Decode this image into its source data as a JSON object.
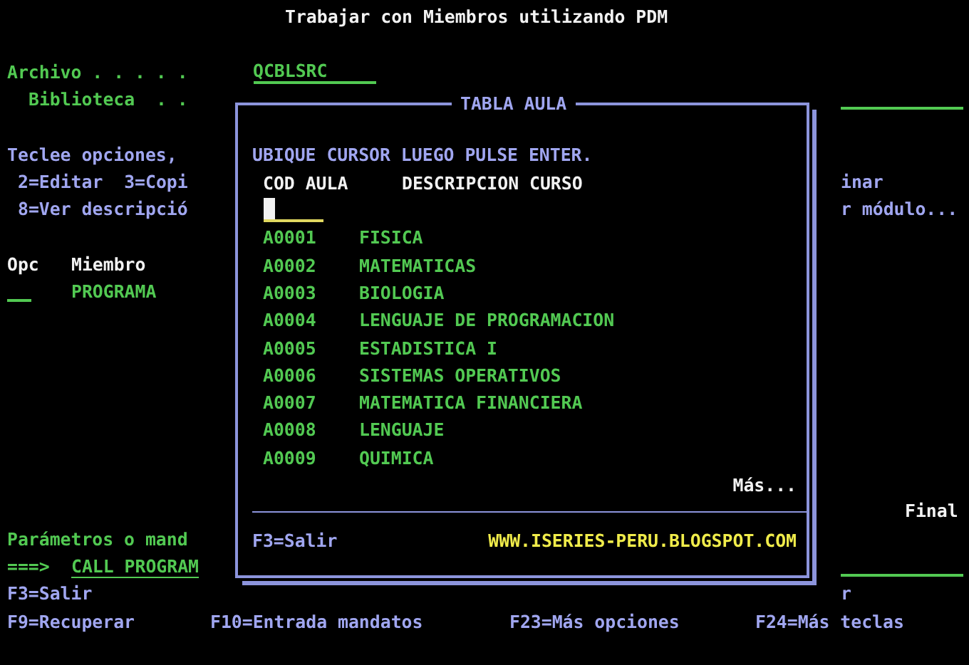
{
  "title": "Trabajar con Miembros utilizando PDM",
  "file": {
    "label": "Archivo . . . . .",
    "value": "QCBLSRC"
  },
  "library": {
    "label": "Biblioteca  . ."
  },
  "instructions": "Teclee opciones,",
  "option_lines": [
    {
      "left": "2=Editar  3=Copi",
      "right": "inar"
    },
    {
      "left": "8=Ver descripció",
      "right": "r módulo..."
    }
  ],
  "list": {
    "columns": [
      "Opc",
      "Miembro"
    ],
    "rows": [
      {
        "member": "PROGRAMA"
      }
    ],
    "status": "Final"
  },
  "command": {
    "label": "Parámetros o mand",
    "prompt": "===>",
    "value": "CALL PROGRAM"
  },
  "function_key_rows": [
    {
      "keys": [
        "F3=Salir"
      ],
      "fragment": "r"
    },
    {
      "keys": [
        "F9=Recuperar",
        "F10=Entrada mandatos",
        "F23=Más opciones",
        "F24=Más teclas"
      ]
    }
  ],
  "popup": {
    "title": "TABLA AULA",
    "instruction": "UBIQUE CURSOR LUEGO PULSE ENTER.",
    "columns": [
      "COD AULA",
      "DESCRIPCION CURSO"
    ],
    "rows": [
      {
        "code": "A0001",
        "description": "FISICA"
      },
      {
        "code": "A0002",
        "description": "MATEMATICAS"
      },
      {
        "code": "A0003",
        "description": "BIOLOGIA"
      },
      {
        "code": "A0004",
        "description": "LENGUAJE DE PROGRAMACION"
      },
      {
        "code": "A0005",
        "description": "ESTADISTICA I"
      },
      {
        "code": "A0006",
        "description": "SISTEMAS OPERATIVOS"
      },
      {
        "code": "A0007",
        "description": "MATEMATICA FINANCIERA"
      },
      {
        "code": "A0008",
        "description": "LENGUAJE"
      },
      {
        "code": "A0009",
        "description": "QUIMICA"
      }
    ],
    "more": "Más...",
    "function_key": "F3=Salir",
    "footer_link": "WWW.ISERIES-PERU.BLOGSPOT.COM"
  }
}
